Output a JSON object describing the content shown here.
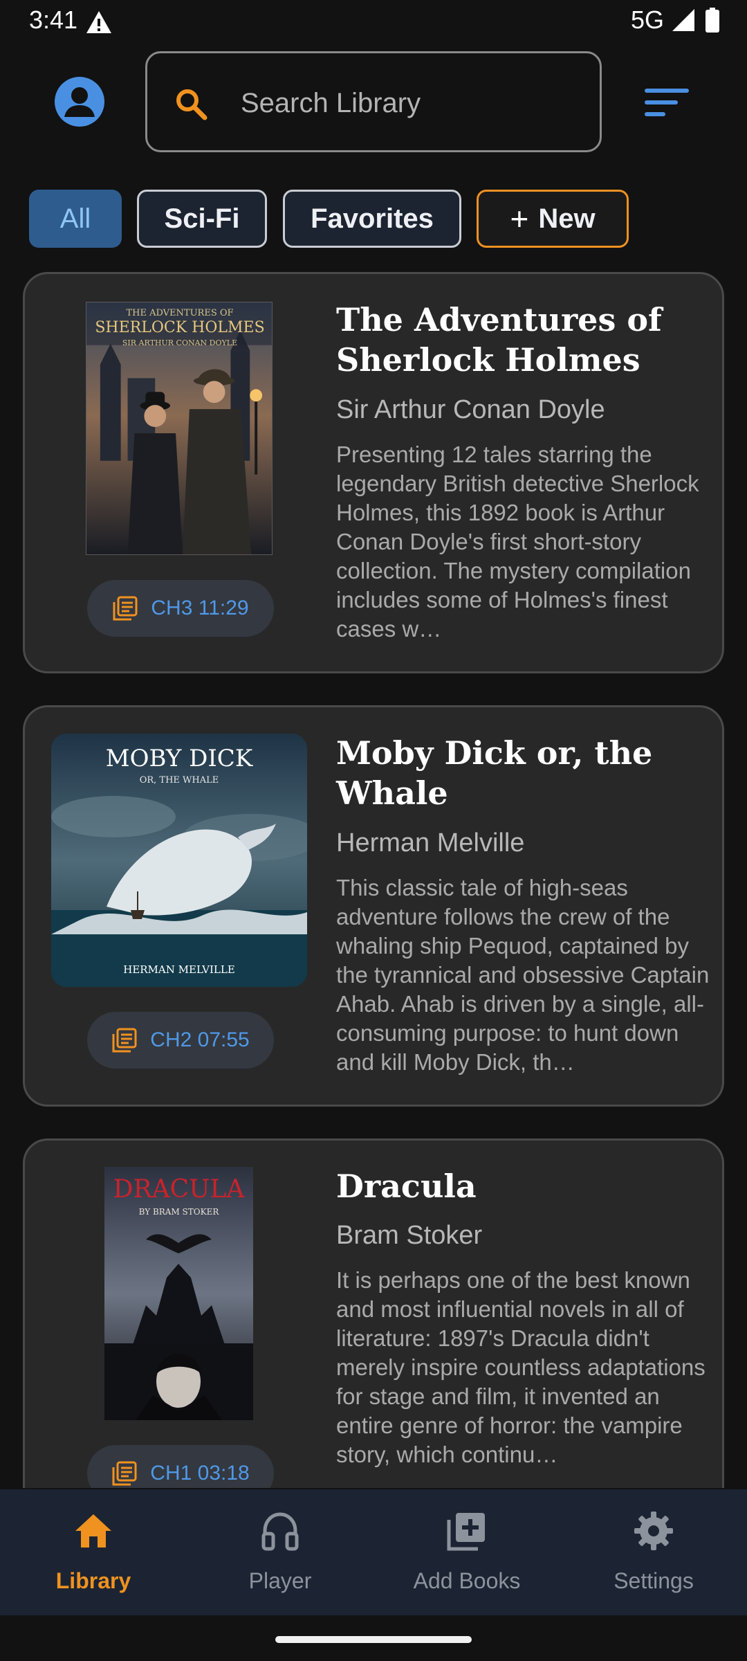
{
  "status_bar": {
    "time": "3:41",
    "network": "5G",
    "icons": [
      "alert-triangle-icon",
      "signal-icon",
      "battery-icon"
    ]
  },
  "top_bar": {
    "avatar_icon": "account-circle-icon",
    "search": {
      "placeholder": "Search Library",
      "value": "",
      "icon": "search-icon"
    },
    "sort_icon": "sort-icon"
  },
  "filters": {
    "chips": [
      {
        "label": "All",
        "selected": true
      },
      {
        "label": "Sci-Fi",
        "selected": false
      },
      {
        "label": "Favorites",
        "selected": false
      },
      {
        "label": "New",
        "icon": "plus-icon",
        "selected": false
      }
    ]
  },
  "books": [
    {
      "title": "The Adventures of Sherlock Holmes",
      "author": "Sir Arthur Conan Doyle",
      "description": "Presenting 12 tales starring the legendary British detective Sherlock Holmes, this 1892 book is Arthur Conan Doyle's first short-story collection. The mystery compilation includes some of Holmes's finest cases w…",
      "progress": "CH3 11:29",
      "cover": {
        "line1": "THE ADVENTURES OF",
        "line2": "SHERLOCK HOLMES",
        "line3": "SIR ARTHUR CONAN DOYLE"
      }
    },
    {
      "title": "Moby Dick or, the Whale",
      "author": "Herman Melville",
      "description": "This classic tale of high-seas adventure follows the crew of the whaling ship Pequod, captained by the tyrannical and obsessive Captain Ahab. Ahab is driven by a single, all-consuming purpose: to hunt down and kill Moby Dick, th…",
      "progress": "CH2 07:55",
      "cover": {
        "line1": "MOBY DICK",
        "line2": "OR, THE WHALE",
        "line3": "HERMAN MELVILLE"
      }
    },
    {
      "title": "Dracula",
      "author": "Bram Stoker",
      "description": "It is perhaps one of the best known and most influential novels in all of literature: 1897's Dracula didn't merely inspire countless adaptations for stage and film, it invented an entire genre of horror: the vampire story, which continu…",
      "progress": "CH1 03:18",
      "cover": {
        "line1": "DRACULA",
        "line2": "BY BRAM STOKER"
      }
    }
  ],
  "bottom_nav": {
    "items": [
      {
        "label": "Library",
        "icon": "home-icon",
        "active": true
      },
      {
        "label": "Player",
        "icon": "headphones-icon",
        "active": false
      },
      {
        "label": "Add Books",
        "icon": "add-library-icon",
        "active": false
      },
      {
        "label": "Settings",
        "icon": "gear-icon",
        "active": false
      }
    ]
  },
  "colors": {
    "background": "#121212",
    "card": "#282828",
    "accent_orange": "#f0921f",
    "accent_blue": "#4f99e8",
    "chip_selected_bg": "#2f5c8f",
    "nav_bg": "#1c2433"
  }
}
